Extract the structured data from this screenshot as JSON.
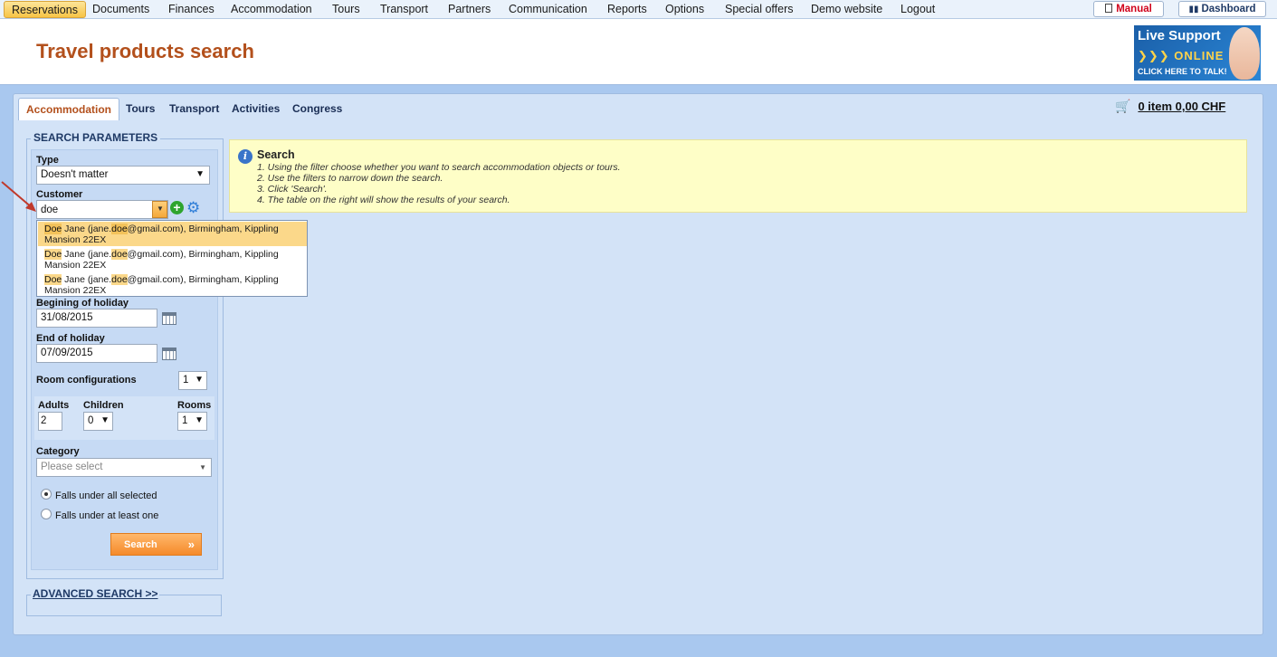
{
  "topnav": {
    "items": [
      "Reservations",
      "Documents",
      "Finances",
      "Accommodation",
      "Tours",
      "Transport",
      "Partners",
      "Communication",
      "Reports",
      "Options",
      "Special offers",
      "Demo website",
      "Logout"
    ],
    "manual": "Manual",
    "dashboard": "Dashboard"
  },
  "header": {
    "title": "Travel products search",
    "live_support": {
      "line1": "Live Support",
      "line2": "ONLINE",
      "line3": "CLICK HERE TO TALK!"
    }
  },
  "tabs": [
    "Accommodation",
    "Tours",
    "Transport",
    "Activities",
    "Congress"
  ],
  "cart": {
    "label": "0 item 0,00 CHF"
  },
  "params": {
    "legend": "SEARCH PARAMETERS",
    "type_label": "Type",
    "type_value": "Doesn't matter",
    "customer_label": "Customer",
    "customer_value": "doe",
    "suggestions": [
      {
        "pre": "",
        "hl1": "Doe",
        "mid": " Jane (jane.",
        "hl2": "doe",
        "post": "@gmail.com), Birmingham, Kippling",
        "line2": "Mansion 22EX"
      },
      {
        "pre": "",
        "hl1": "Doe",
        "mid": " Jane (jane.",
        "hl2": "doe",
        "post": "@gmail.com), Birmingham, Kippling",
        "line2": "Mansion 22EX"
      },
      {
        "pre": "",
        "hl1": "Doe",
        "mid": " Jane (jane.",
        "hl2": "doe",
        "post": "@gmail.com), Birmingham, Kippling",
        "line2": "Mansion 22EX"
      }
    ],
    "begin_label": "Begining of holiday",
    "begin_value": "31/08/2015",
    "end_label": "End of holiday",
    "end_value": "07/09/2015",
    "room_config_label": "Room configurations",
    "room_config_value": "1",
    "adults_label": "Adults",
    "adults_value": "2",
    "children_label": "Children",
    "children_value": "0",
    "rooms_label": "Rooms",
    "rooms_value": "1",
    "category_label": "Category",
    "category_placeholder": "Please select",
    "radio_all": "Falls under all selected",
    "radio_one": "Falls under at least one",
    "search_button": "Search"
  },
  "advanced": {
    "label": "ADVANCED SEARCH >>"
  },
  "info": {
    "title": "Search",
    "lines": [
      "1. Using the filter choose whether you want to search accommodation objects or tours.",
      "2. Use the filters to narrow down the search.",
      "3. Click 'Search'.",
      "4. The table on the right will show the results of your search."
    ]
  }
}
